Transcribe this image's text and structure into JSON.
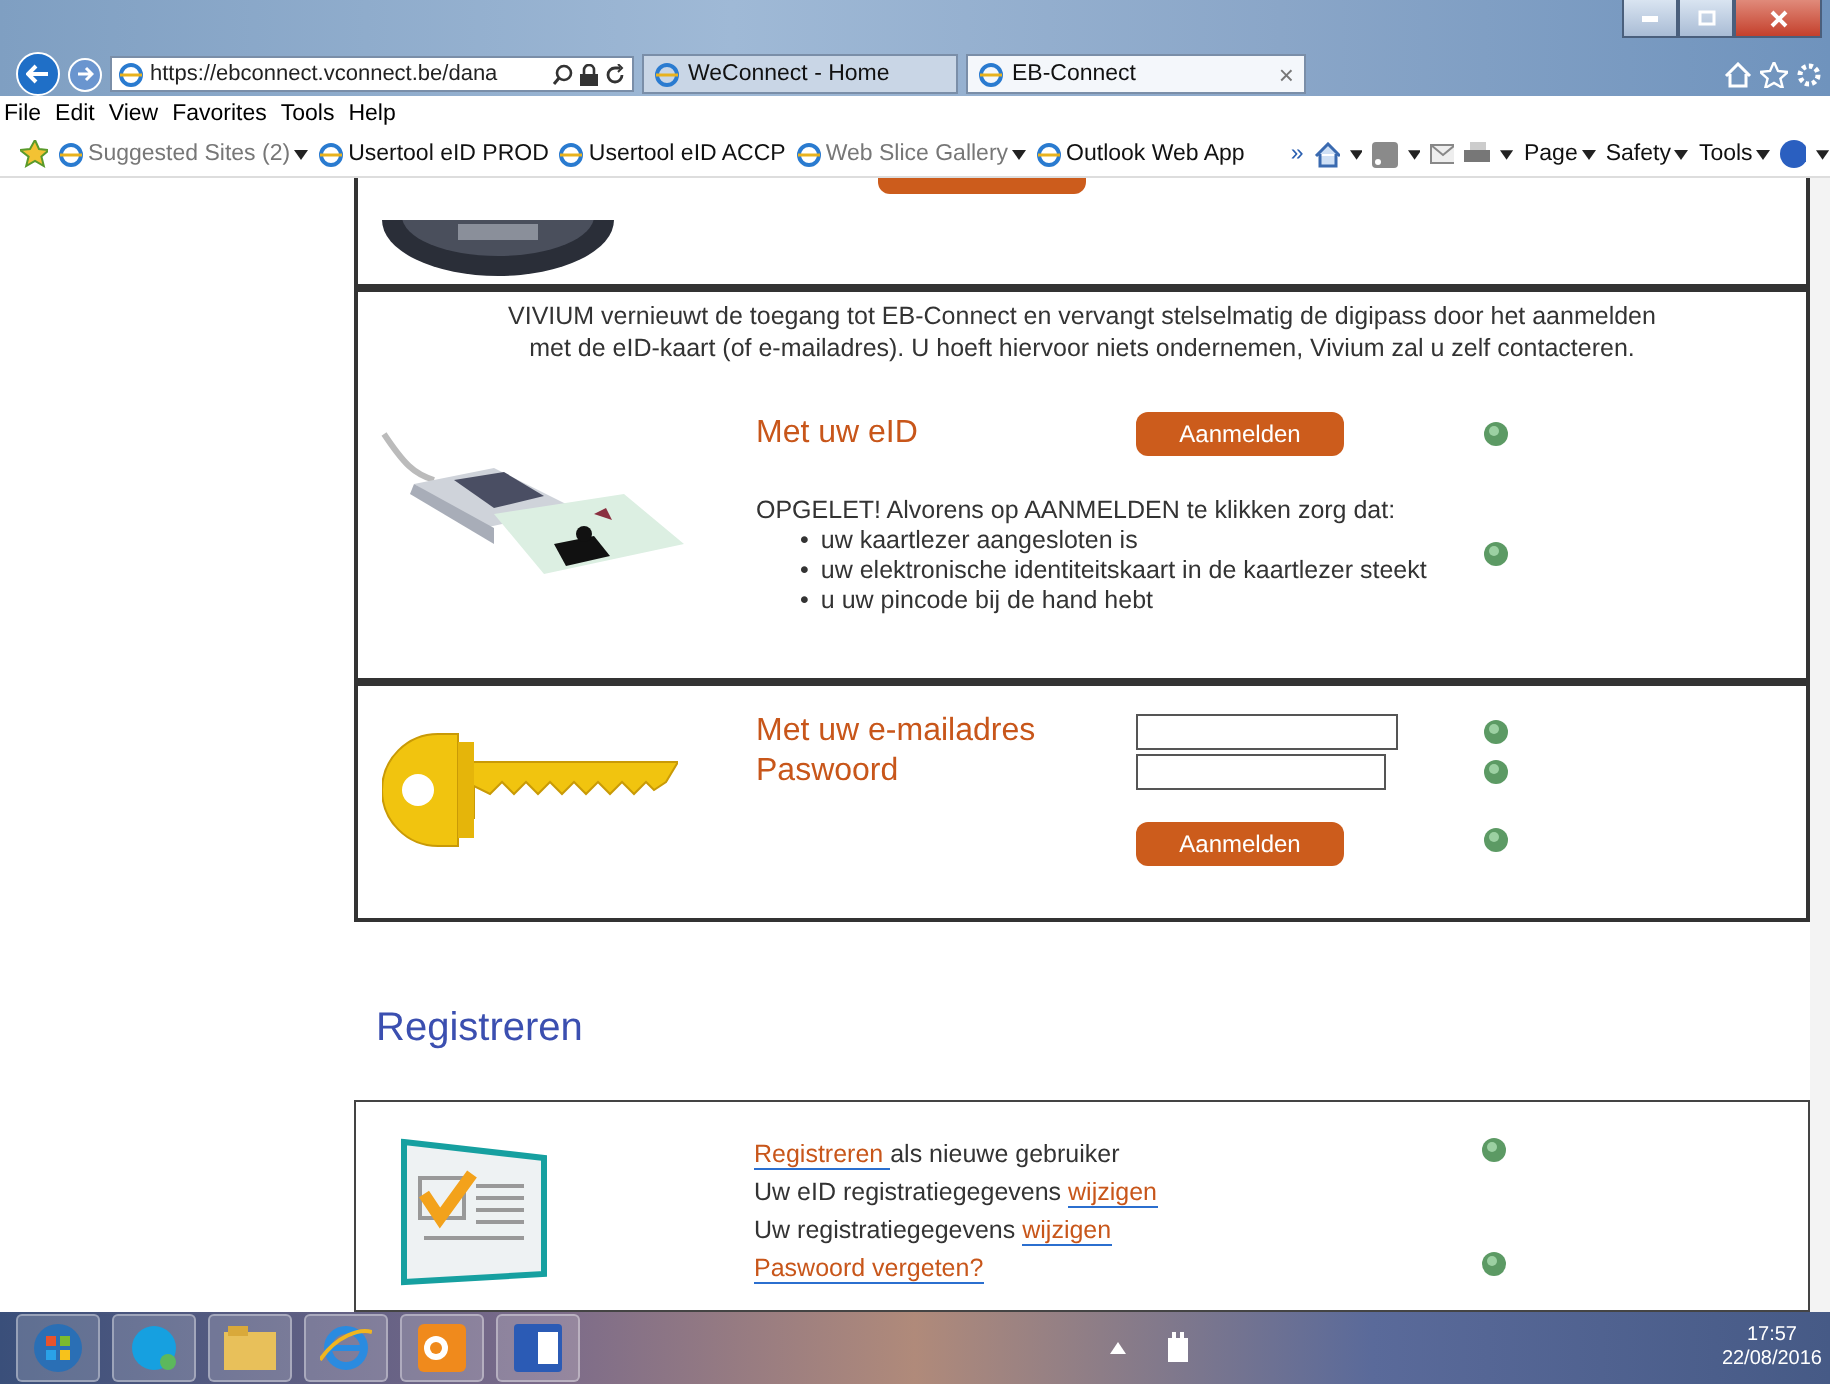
{
  "browser": {
    "address": "https://ebconnect.vconnect.be/dana",
    "tabs": [
      {
        "label": "WeConnect - Home",
        "selected": false,
        "closable": false
      },
      {
        "label": "EB-Connect",
        "selected": true,
        "closable": true
      }
    ],
    "close_glyph": "×",
    "menu": [
      "File",
      "Edit",
      "View",
      "Favorites",
      "Tools",
      "Help"
    ],
    "favorites": [
      {
        "label": "Suggested Sites (2)",
        "dropdown": true,
        "dim": true
      },
      {
        "label": "Usertool eID PROD",
        "dropdown": false,
        "dim": false
      },
      {
        "label": "Usertool eID ACCP",
        "dropdown": false,
        "dim": false
      },
      {
        "label": "Web Slice Gallery",
        "dropdown": true,
        "dim": true
      },
      {
        "label": "Outlook Web App",
        "dropdown": false,
        "dim": false
      }
    ],
    "overflow": "»",
    "commands": [
      "Page",
      "Safety",
      "Tools"
    ]
  },
  "eid_section": {
    "intro": "VIVIUM vernieuwt de toegang tot EB-Connect en vervangt stelselmatig de digipass door het aanmelden met de eID-kaart (of e-mailadres). U hoeft hiervoor niets ondernemen, Vivium zal u zelf contacteren.",
    "label": "Met uw eID",
    "button": "Aanmelden",
    "warning": "OPGELET! Alvorens op AANMELDEN te klikken zorg dat:",
    "bullet": "•",
    "items": [
      "uw kaartlezer aangesloten is",
      "uw elektronische identiteitskaart in de kaartlezer steekt",
      "u uw pincode bij de hand hebt"
    ]
  },
  "email_section": {
    "email_label": "Met uw e-mailadres",
    "password_label": "Paswoord",
    "button": "Aanmelden"
  },
  "register": {
    "heading": "Registreren",
    "lines": [
      {
        "help": true,
        "parts": [
          {
            "text": "Registreren ",
            "link": true
          },
          {
            "text": "als nieuwe gebruiker",
            "link": false
          }
        ]
      },
      {
        "help": false,
        "parts": [
          {
            "text": "Uw eID registratiegegevens ",
            "link": false
          },
          {
            "text": "wijzigen",
            "link": true
          }
        ]
      },
      {
        "help": false,
        "parts": [
          {
            "text": "Uw registratiegegevens ",
            "link": false
          },
          {
            "text": "wijzigen",
            "link": true
          }
        ]
      },
      {
        "help": true,
        "parts": [
          {
            "text": "Paswoord vergeten?",
            "link": true
          }
        ]
      }
    ]
  },
  "taskbar": {
    "time": "17:57",
    "date": "22/08/2016"
  }
}
